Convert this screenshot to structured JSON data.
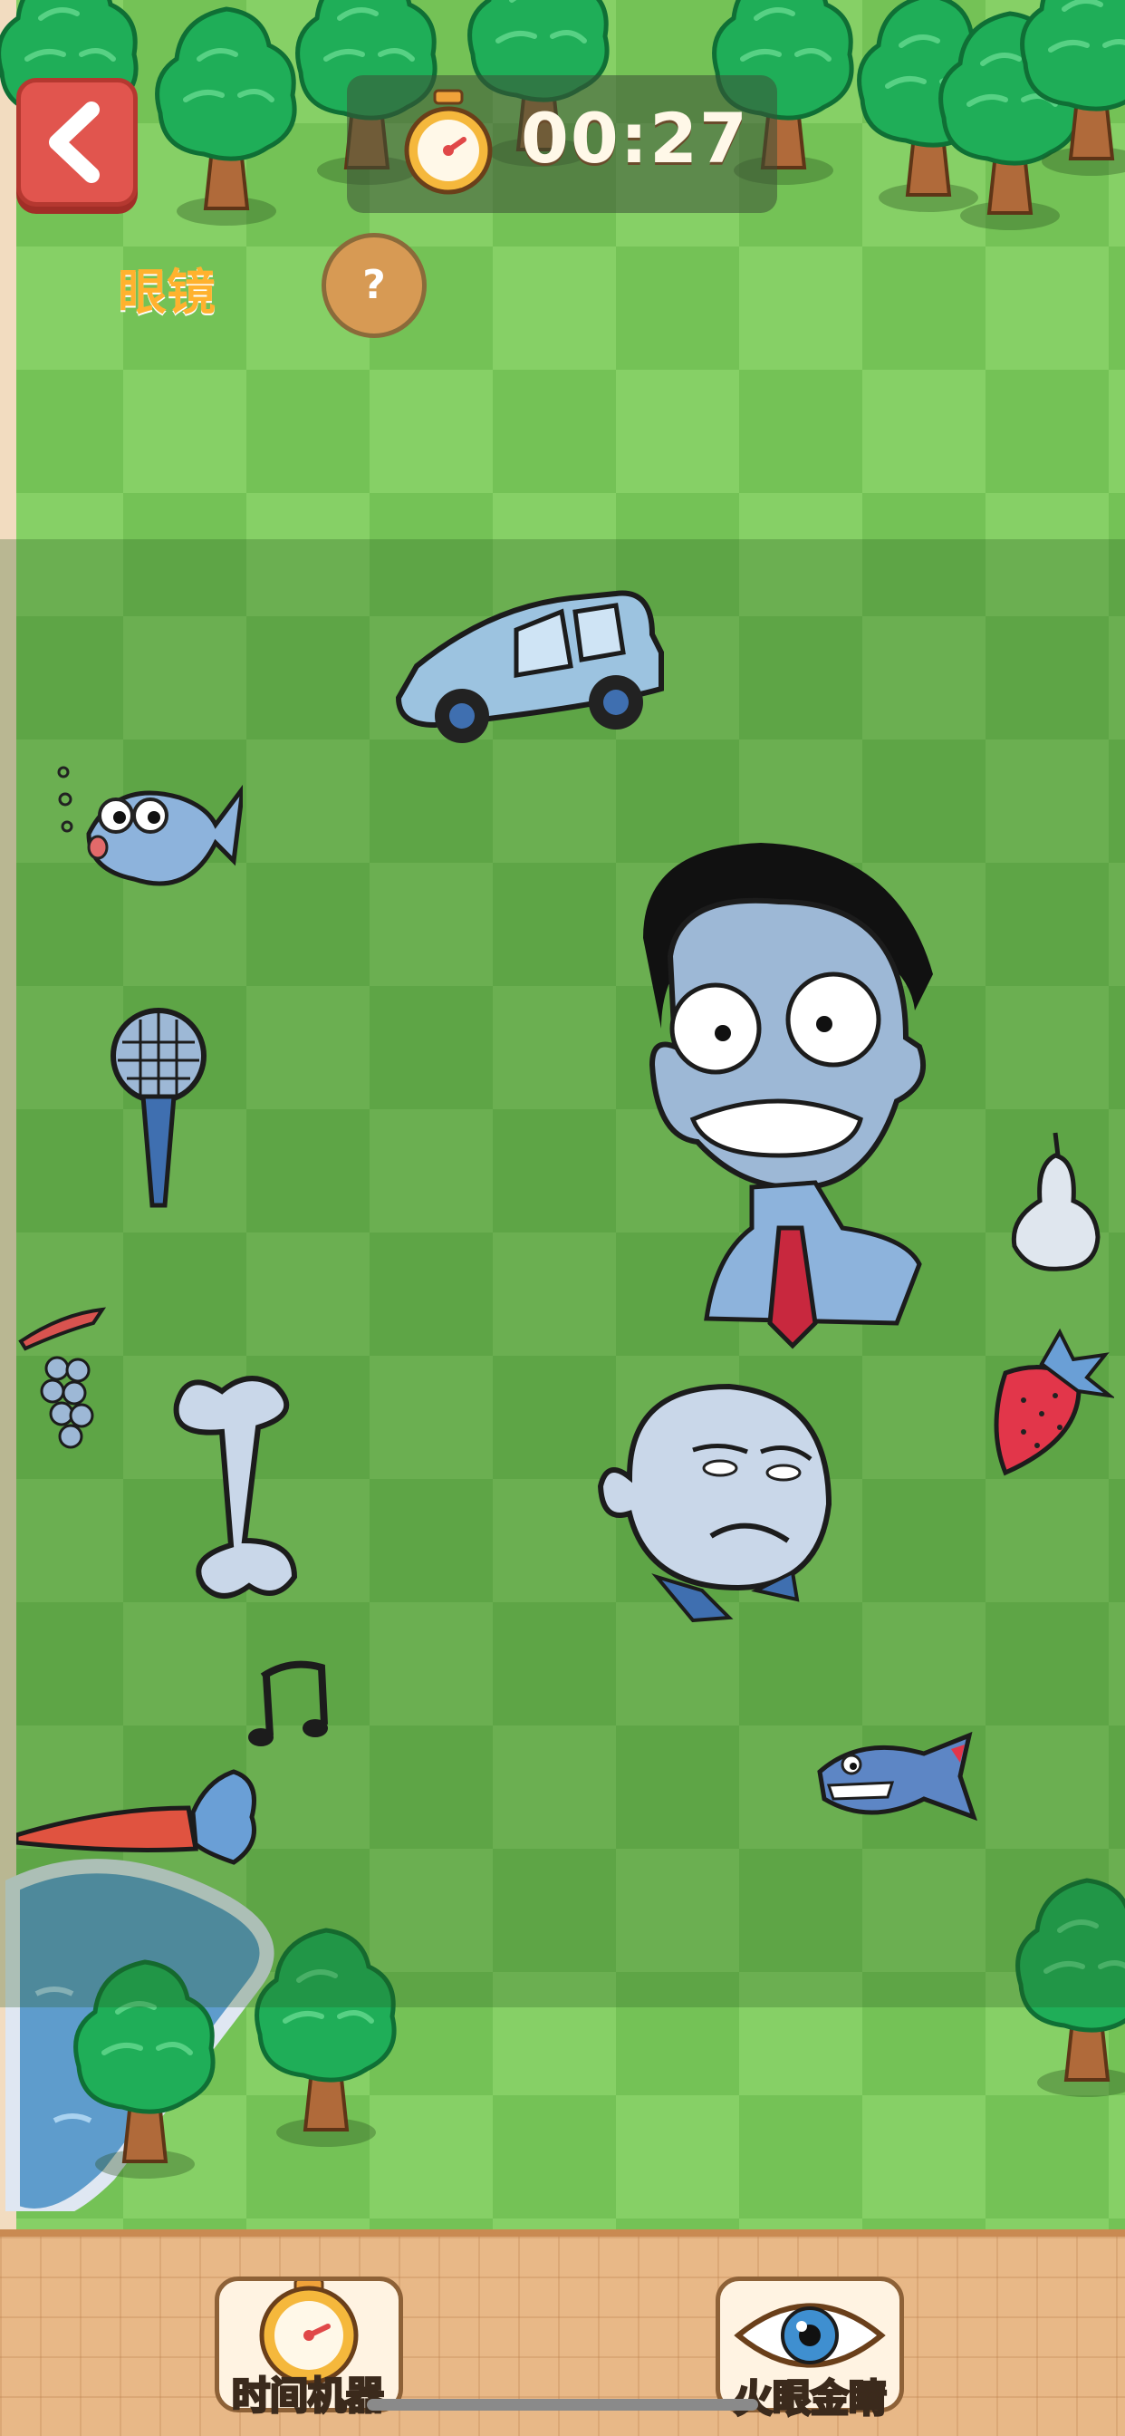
{
  "header": {
    "timer": "00:27",
    "target_word": "眼镜",
    "hint_symbol": "?"
  },
  "powerups": [
    {
      "label": "时间机器",
      "icon": "stopwatch-icon"
    },
    {
      "label": "火眼金睛",
      "icon": "eye-icon"
    }
  ],
  "scene_items": [
    "car",
    "fish",
    "microphone",
    "grapes",
    "bone",
    "music-note",
    "carrot",
    "angry-man-head",
    "old-man-head",
    "pear",
    "strawberry",
    "piranha",
    "pond",
    "trees"
  ],
  "colors": {
    "grass_light": "#86d066",
    "grass_dark": "#74c256",
    "back_button": "#e1554e",
    "label_orange": "#ffb22e",
    "bottom_bar": "#e8b887"
  }
}
